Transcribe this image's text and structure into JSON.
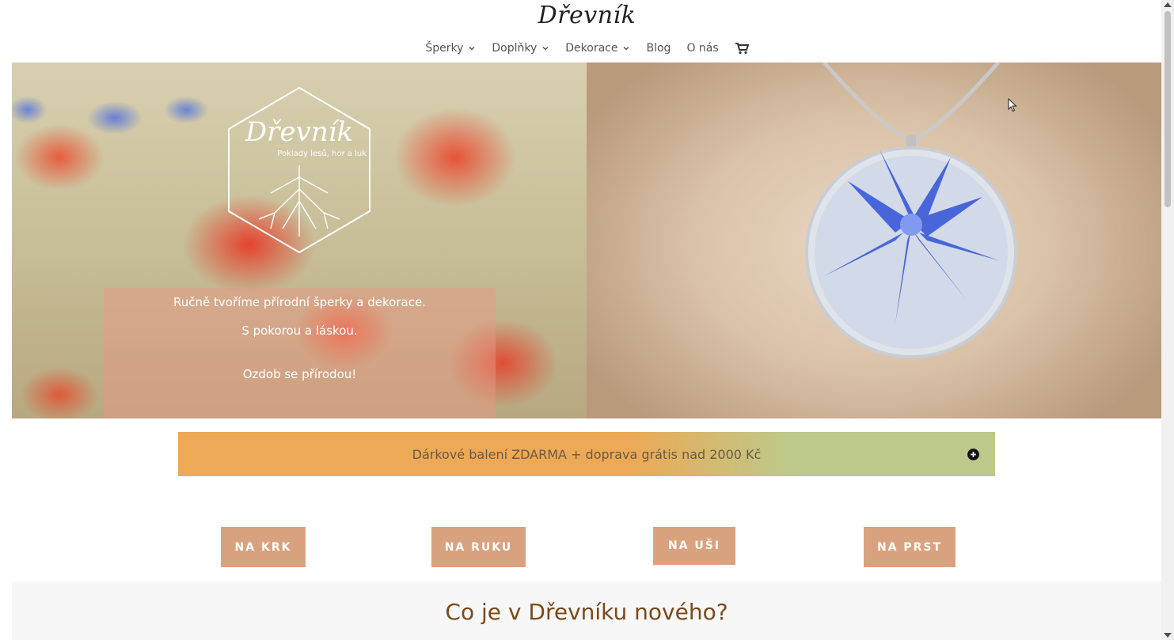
{
  "header": {
    "logo": "Dřevník"
  },
  "nav": {
    "items": [
      {
        "label": "Šperky",
        "has_dropdown": true
      },
      {
        "label": "Doplňky",
        "has_dropdown": true
      },
      {
        "label": "Dekorace",
        "has_dropdown": true
      },
      {
        "label": "Blog",
        "has_dropdown": false
      },
      {
        "label": "O nás",
        "has_dropdown": false
      }
    ],
    "cart_icon": "shopping-cart-icon"
  },
  "hero": {
    "emblem_title": "Dřevník",
    "emblem_subtitle": "Poklady lesů, hor a luk",
    "line1": "Ručně tvoříme přírodní šperky a dekorace.",
    "line2": "S pokorou a láskou.",
    "line3": "Ozdob se přírodou!"
  },
  "banner": {
    "text": "Dárkové balení ZDARMA + doprava grátis nad 2000 Kč",
    "toggle_icon": "plus-circle-icon"
  },
  "categories": [
    {
      "label": "NA KRK"
    },
    {
      "label": "NA RUKU"
    },
    {
      "label": "NA UŠI"
    },
    {
      "label": "NA PRST"
    }
  ],
  "news": {
    "title": "Co je v Dřevníku nového?"
  },
  "colors": {
    "accent_button": "#d9a27e",
    "banner_orange": "#eda955",
    "banner_green": "#bcc98a",
    "heading_brown": "#7a4a1a"
  }
}
